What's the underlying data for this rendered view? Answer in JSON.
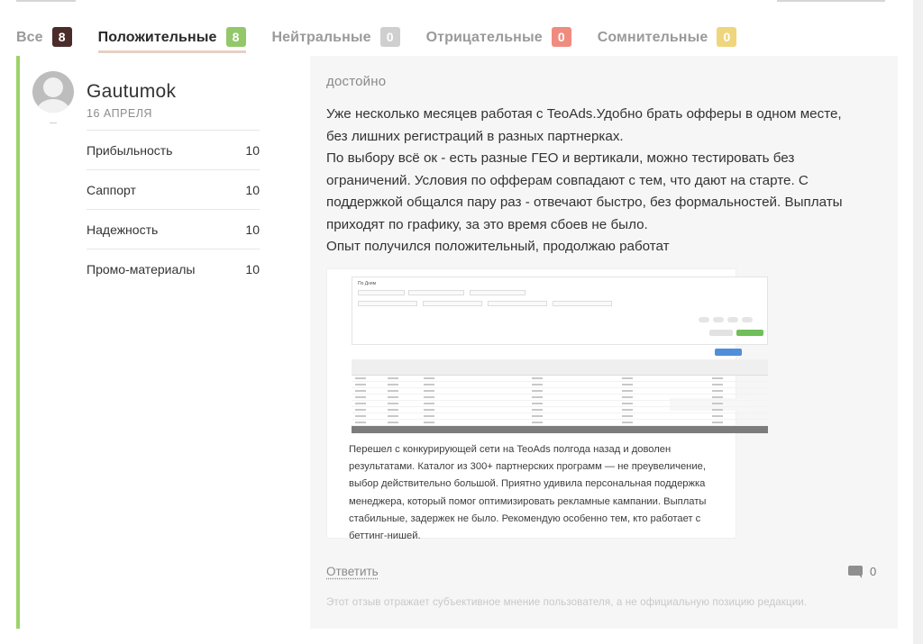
{
  "tabs": [
    {
      "label": "Все",
      "count": "8",
      "color": "#4a2c2a",
      "active": false
    },
    {
      "label": "Положительные",
      "count": "8",
      "color": "#93c86a",
      "active": true
    },
    {
      "label": "Нейтральные",
      "count": "0",
      "color": "#cfcfcf",
      "active": false
    },
    {
      "label": "Отрицательные",
      "count": "0",
      "color": "#f08b7f",
      "active": false
    },
    {
      "label": "Сомнительные",
      "count": "0",
      "color": "#efd57c",
      "active": false
    }
  ],
  "review": {
    "accent_color": "#9dd36a",
    "author": {
      "name": "Gautumok",
      "date": "16 АПРЕЛЯ"
    },
    "ratings": [
      {
        "label": "Прибыльность",
        "value": "10"
      },
      {
        "label": "Саппорт",
        "value": "10"
      },
      {
        "label": "Надежность",
        "value": "10"
      },
      {
        "label": "Промо-материалы",
        "value": "10"
      }
    ],
    "verdict": "достойно",
    "text_lines": [
      "Уже несколько месяцев работая с TeoAds.Удобно брать офферы в одном месте,",
      "без лишних регистраций в разных партнерках.",
      "По выбору всё ок - есть разные ГЕО и вертикали, можно тестировать без",
      "ограничений. Условия по офферам совпадают с тем, что дают на старте. С",
      "поддержкой общался пару раз - отвечают быстро, без формальностей. Выплаты",
      "приходят по графику, за это время сбоев не было.",
      "Опыт получился положительный, продолжаю работат"
    ],
    "attachment": {
      "panel_title": "По Дням",
      "caption_lines": [
        "Перешел с конкурирующей сети на TeoAds полгода назад и доволен",
        "результатами. Каталог из 300+ партнерских программ — не преувеличение,",
        "выбор действительно большой. Приятно удивила персональная поддержка",
        "менеджера, который помог оптимизировать рекламные кампании. Выплаты",
        "стабильные, задержек не было. Рекомендую особенно тем, кто работает с",
        "беттинг-нишей."
      ]
    },
    "reply_label": "Ответить",
    "comment_icon": "comment-icon",
    "comment_count": "0",
    "disclaimer": "Этот отзыв отражает субъективное мнение пользователя, а не официальную позицию редакции."
  }
}
